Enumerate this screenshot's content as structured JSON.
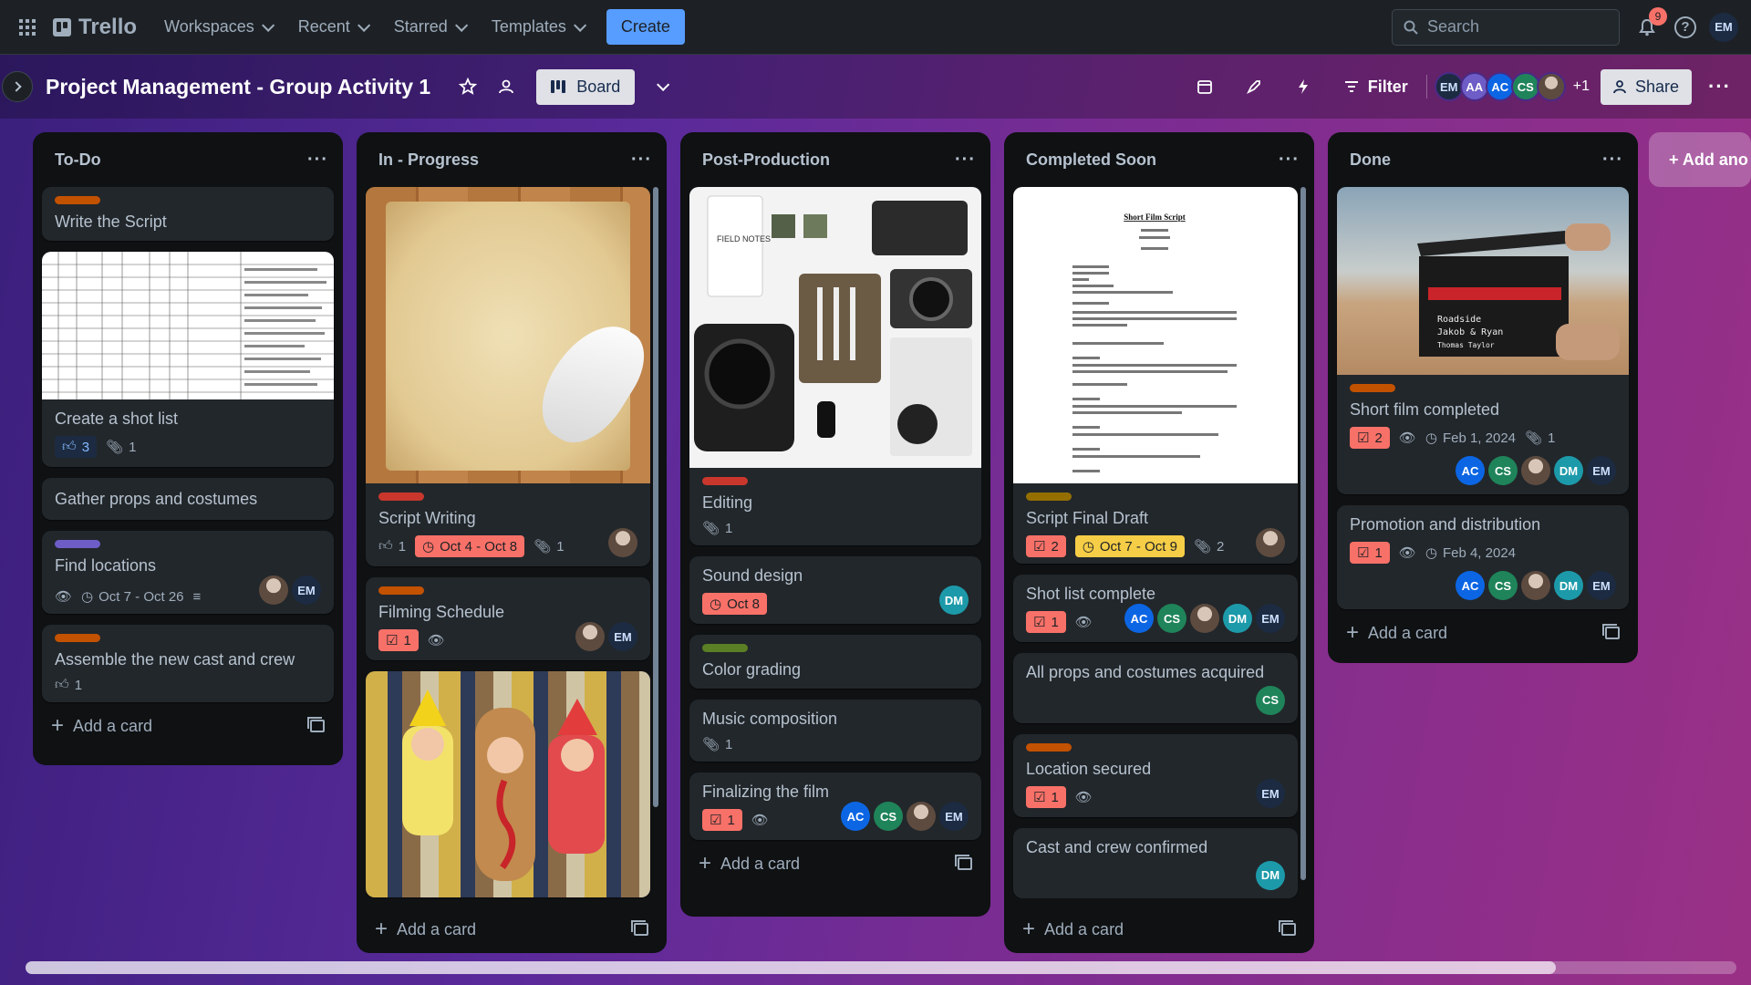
{
  "nav": {
    "logo": "Trello",
    "menu": [
      {
        "label": "Workspaces"
      },
      {
        "label": "Recent"
      },
      {
        "label": "Starred"
      },
      {
        "label": "Templates"
      }
    ],
    "create": "Create",
    "search_placeholder": "Search",
    "notifications_count": "9",
    "user_initials": "EM"
  },
  "board": {
    "title": "Project Management - Group Activity 1",
    "view": "Board",
    "filter": "Filter",
    "members": [
      "EM",
      "AA",
      "AC",
      "CS"
    ],
    "more_members": "+1",
    "share": "Share",
    "add_list": "+ Add ano"
  },
  "lists": [
    {
      "title": "To-Do",
      "add_card": "Add a card",
      "cards": [
        {
          "title": "Write the Script",
          "label_color": "#c25100"
        },
        {
          "title": "Create a shot list",
          "votes": "3",
          "attachments": "1"
        },
        {
          "title": "Gather props and costumes"
        },
        {
          "title": "Find locations",
          "label_color": "#6e5dc6",
          "dates": "Oct 7 - Oct 26",
          "members": [
            "EM"
          ]
        },
        {
          "title": "Assemble the new cast and crew",
          "label_color": "#c25100",
          "votes": "1"
        }
      ]
    },
    {
      "title": "In - Progress",
      "add_card": "Add a card",
      "cards": [
        {
          "title": "Script Writing",
          "label_color": "#c9372c",
          "votes": "1",
          "dates": "Oct 4 - Oct 8",
          "attachments": "1"
        },
        {
          "title": "Filming Schedule",
          "label_color": "#c25100",
          "checklist": "1",
          "members": [
            "EM"
          ]
        }
      ]
    },
    {
      "title": "Post-Production",
      "add_card": "Add a card",
      "cards": [
        {
          "title": "Editing",
          "label_color": "#c9372c",
          "attachments": "1"
        },
        {
          "title": "Sound design",
          "dates": "Oct 8",
          "members": [
            "DM"
          ]
        },
        {
          "title": "Color grading",
          "label_color": "#5b7f24"
        },
        {
          "title": "Music composition",
          "attachments": "1"
        },
        {
          "title": "Finalizing the film",
          "checklist": "1",
          "members": [
            "AC",
            "CS",
            "EM"
          ]
        }
      ]
    },
    {
      "title": "Completed Soon",
      "add_card": "Add a card",
      "cards": [
        {
          "title": "Script Final Draft",
          "label_color": "#946f00",
          "checklist": "2",
          "dates": "Oct 7 - Oct 9",
          "attachments": "2"
        },
        {
          "title": "Shot list complete",
          "checklist": "1",
          "members": [
            "AC",
            "CS",
            "DM",
            "EM"
          ]
        },
        {
          "title": "All props and costumes acquired",
          "members": [
            "CS"
          ]
        },
        {
          "title": "Location secured",
          "label_color": "#c25100",
          "checklist": "1",
          "members": [
            "EM"
          ]
        },
        {
          "title": "Cast and crew confirmed",
          "members": [
            "DM"
          ]
        }
      ]
    },
    {
      "title": "Done",
      "add_card": "Add a card",
      "cards": [
        {
          "title": "Short film completed",
          "label_color": "#c25100",
          "checklist": "2",
          "dates": "Feb 1, 2024",
          "attachments": "1",
          "members": [
            "AC",
            "CS",
            "DM",
            "EM"
          ]
        },
        {
          "title": "Promotion and distribution",
          "checklist": "1",
          "dates": "Feb 4, 2024",
          "members": [
            "AC",
            "CS",
            "DM",
            "EM"
          ]
        }
      ]
    }
  ],
  "covers": {
    "script_heading": "Short Film Script",
    "clapper_lines": [
      "Roadside",
      "Jakob & Ryan",
      "Thomas Taylor"
    ],
    "field_notes": "FIELD NOTES"
  }
}
